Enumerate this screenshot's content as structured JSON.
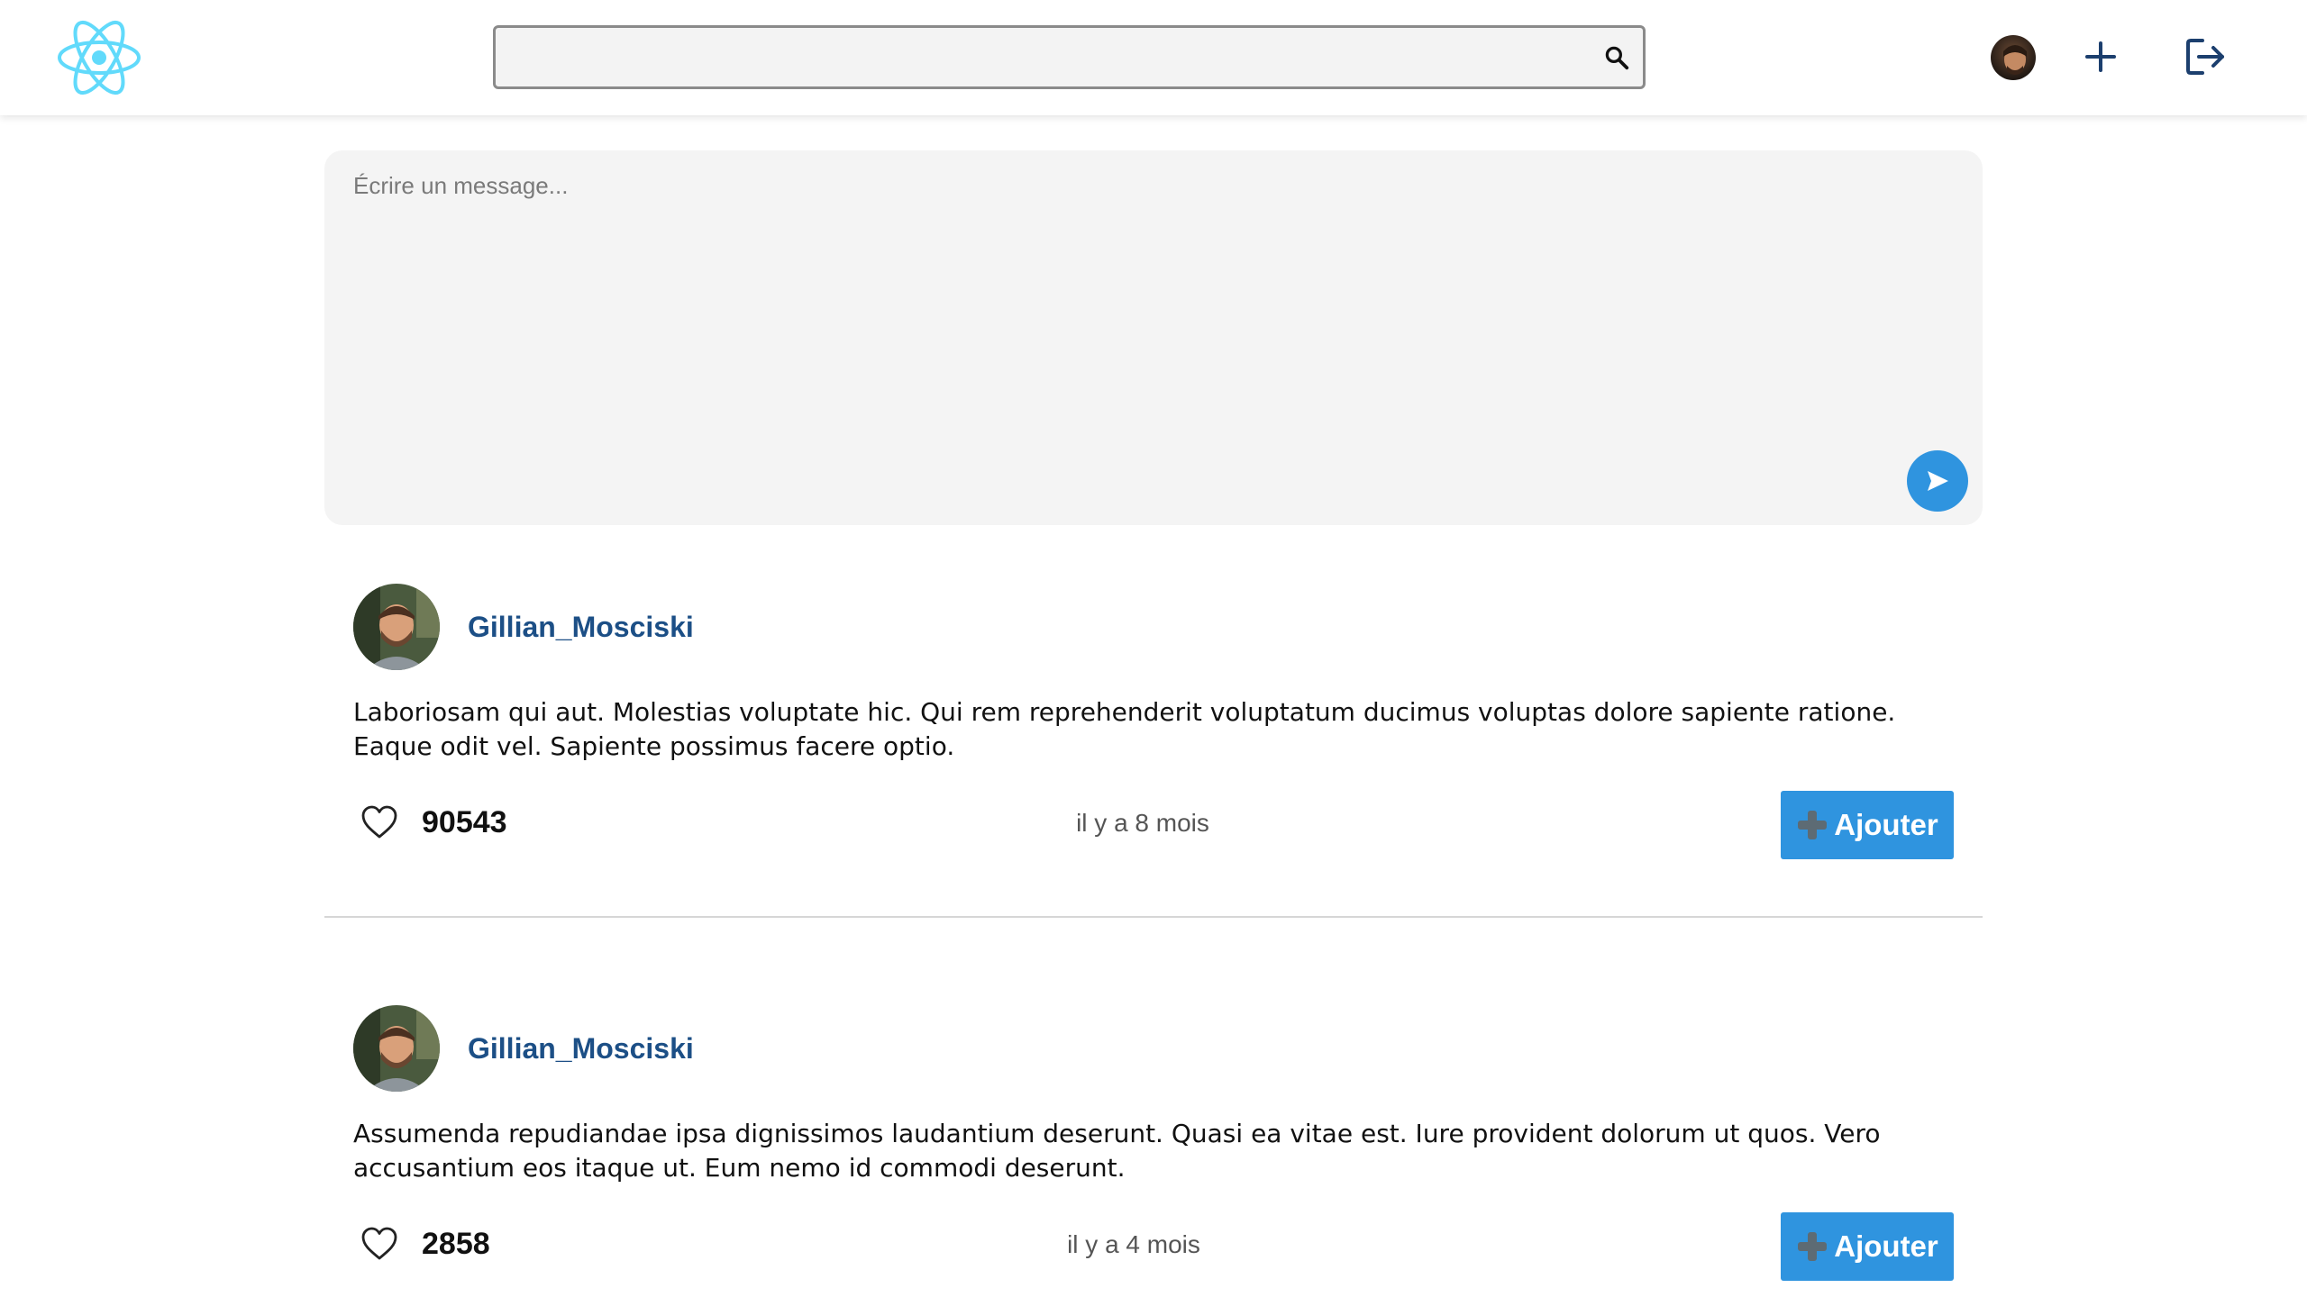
{
  "header": {
    "logo_icon": "react-atom-icon",
    "search": {
      "value": "",
      "placeholder": "",
      "icon": "search-icon"
    },
    "icons": [
      "user-avatar",
      "plus-icon",
      "logout-icon"
    ]
  },
  "composer": {
    "placeholder": "Écrire un message...",
    "send_icon": "send-icon"
  },
  "colors": {
    "accent": "#2f94df",
    "author": "#1c4f86",
    "logo": "#61dafb",
    "header_icons": "#1c3f6e"
  },
  "posts": [
    {
      "author": "Gillian_Mosciski",
      "text": "Laboriosam qui aut. Molestias voluptate hic. Qui rem reprehenderit voluptatum ducimus voluptas dolore sapiente ratione. Eaque odit vel. Sapiente possimus facere optio.",
      "likes": "90543",
      "time": "il y a 8 mois",
      "button_label": "Ajouter"
    },
    {
      "author": "Gillian_Mosciski",
      "text": "Assumenda repudiandae ipsa dignissimos laudantium deserunt. Quasi ea vitae est. Iure provident dolorum ut quos. Vero accusantium eos itaque ut. Eum nemo id commodi deserunt.",
      "likes": "2858",
      "time": "il y a 4 mois",
      "button_label": "Ajouter"
    }
  ]
}
